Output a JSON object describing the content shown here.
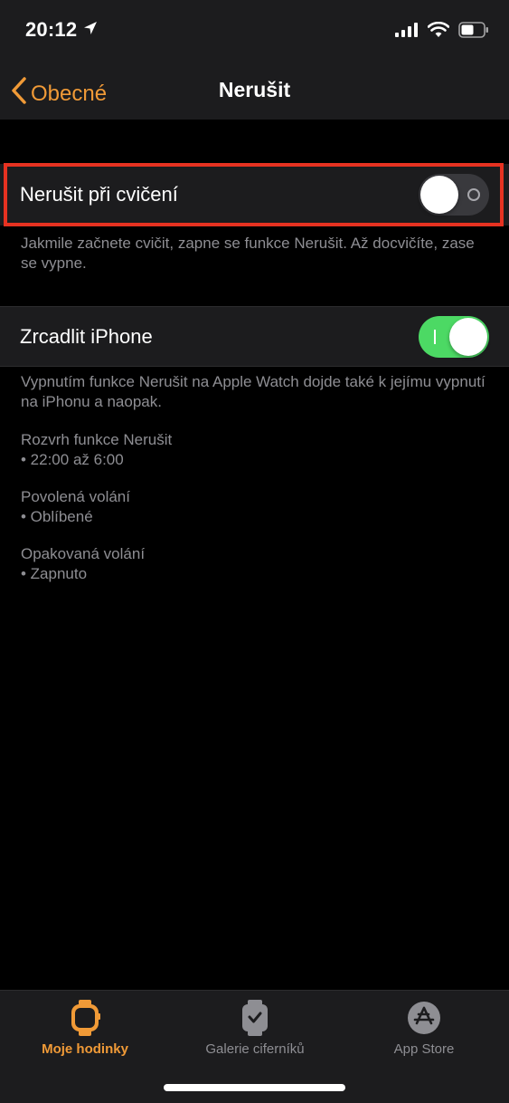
{
  "status_bar": {
    "time": "20:12",
    "icons": [
      "location-arrow-icon",
      "signal-icon",
      "wifi-icon",
      "battery-icon"
    ]
  },
  "nav": {
    "back_label": "Obecné",
    "title": "Nerušit"
  },
  "settings": {
    "workout_dnd": {
      "label": "Nerušit při cvičení",
      "enabled": false,
      "footnote": "Jakmile začnete cvičit, zapne se funkce Nerušit. Až docvičíte, zase se vypne."
    },
    "mirror_iphone": {
      "label": "Zrcadlit iPhone",
      "enabled": true,
      "footnote": "Vypnutím funkce Nerušit na Apple Watch dojde také k jejímu vypnutí na iPhonu a naopak."
    },
    "info": [
      {
        "title": "Rozvrh funkce Nerušit",
        "value": "• 22:00 až 6:00"
      },
      {
        "title": "Povolená volání",
        "value": "• Oblíbené"
      },
      {
        "title": "Opakovaná volání",
        "value": "• Zapnuto"
      }
    ]
  },
  "tab_bar": {
    "tabs": [
      {
        "label": "Moje hodinky",
        "icon": "watch-icon",
        "active": true
      },
      {
        "label": "Galerie ciferníků",
        "icon": "watch-face-icon",
        "active": false
      },
      {
        "label": "App Store",
        "icon": "app-store-icon",
        "active": false
      }
    ]
  },
  "colors": {
    "accent": "#f09a37",
    "toggle_on": "#4cd964",
    "highlight": "#e63221",
    "background": "#000000",
    "panel": "#1c1c1e",
    "secondary_text": "#8e8e93"
  }
}
